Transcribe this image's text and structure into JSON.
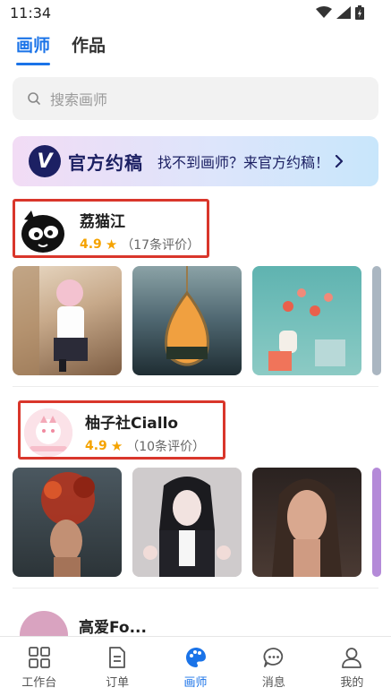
{
  "status": {
    "time": "11:34"
  },
  "top_tabs": [
    {
      "label": "画师",
      "active": true
    },
    {
      "label": "作品",
      "active": false
    }
  ],
  "search": {
    "placeholder": "搜索画师"
  },
  "promo": {
    "badge": "V",
    "title": "官方约稿",
    "subtitle": "找不到画师？来官方约稿！"
  },
  "artists": [
    {
      "name": "荔猫江",
      "rating": "4.9",
      "reviews": "（17条评价）"
    },
    {
      "name": "柚子社Ciallo",
      "rating": "4.9",
      "reviews": "（10条评价）"
    },
    {
      "name": "高爱Fo..."
    }
  ],
  "tab_bar": [
    {
      "label": "工作台",
      "icon": "grid-icon",
      "active": false
    },
    {
      "label": "订单",
      "icon": "document-icon",
      "active": false
    },
    {
      "label": "画师",
      "icon": "palette-icon",
      "active": true
    },
    {
      "label": "消息",
      "icon": "chat-bubble-icon",
      "active": false
    },
    {
      "label": "我的",
      "icon": "person-icon",
      "active": false
    }
  ],
  "colors": {
    "accent": "#1a73e8",
    "highlight_box": "#d9362b",
    "star": "#f5a300",
    "promo_dark": "#1c2063"
  }
}
